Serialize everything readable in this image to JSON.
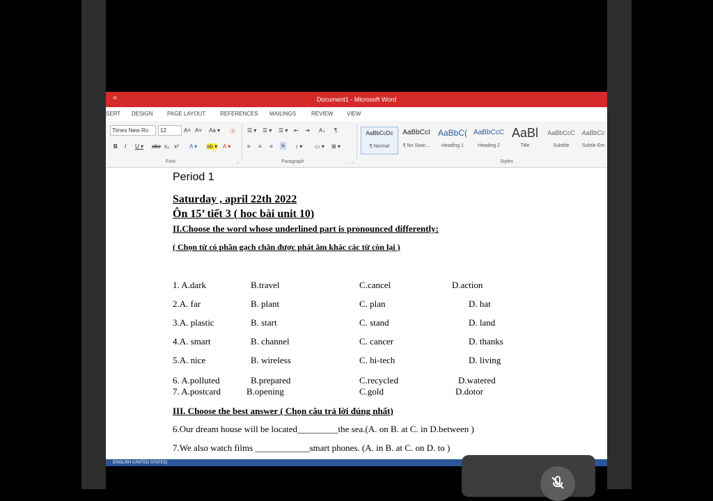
{
  "window": {
    "title": "Document1 - Microsoft Word",
    "quick_access": "="
  },
  "menu": [
    "SERT",
    "DESIGN",
    "PAGE LAYOUT",
    "REFERENCES",
    "MAILINGS",
    "REVIEW",
    "VIEW"
  ],
  "ribbon": {
    "font_name": "Times New Ro",
    "font_size": "12",
    "font_row1": [
      "A˄",
      "A˅",
      "Aa ▾",
      "ⓐ"
    ],
    "font_row2": [
      "B",
      "I",
      "U ▾",
      "abc",
      "x₂",
      "x²",
      "A ▾",
      "ab ▾",
      "A ▾"
    ],
    "paragraph_row1": [
      "☰ ▾",
      "☰ ▾",
      "☰ ▾",
      "⇤",
      "⇥",
      "A↓",
      "¶"
    ],
    "paragraph_row2": [
      "≡",
      "≡",
      "≡",
      "≡",
      "↕ ▾",
      "▭ ▾",
      "⊞ ▾"
    ],
    "groups": {
      "font": "Font",
      "paragraph": "Paragraph",
      "styles": "Styles"
    },
    "styles": [
      {
        "preview": "AaBbCcDc",
        "name": "¶ Normal"
      },
      {
        "preview": "AaBbCcI",
        "name": "¶ No Spac..."
      },
      {
        "preview": "AaBbC(",
        "name": "Heading 1"
      },
      {
        "preview": "AaBbCcC",
        "name": "Heading 2"
      },
      {
        "preview": "AaBl",
        "name": "Title"
      },
      {
        "preview": "AaBbCcC",
        "name": "Subtitle"
      },
      {
        "preview": "AaBbCc",
        "name": "Subtle Em"
      }
    ]
  },
  "document": {
    "period": "Period 1",
    "date": "Saturday , april 22th  2022",
    "subtitle": "Ôn 15’ tiết 3 ( hoc bài unit 10)",
    "section2": "II.Choose the word whose underlined part is pronounced differently:",
    "section2_vn": "( Chọn từ có phần gạch chân được phát âm khác các từ còn lại )",
    "pronunciation_rows": [
      [
        "1. A.dark",
        "B.travel",
        "C.cancel",
        "D.action"
      ],
      [
        "2.A. far",
        "B. plant",
        "C. plan",
        "D. hat"
      ],
      [
        "3.A. plastic",
        "B. start",
        "C. stand",
        "D. land"
      ],
      [
        "4.A. smart",
        "B. channel",
        "C. cancer",
        "D. thanks"
      ],
      [
        "5.A. nice",
        "B. wireless",
        "C. hi-tech",
        "D. living"
      ],
      [
        "6. A.polluted",
        "B.prepared",
        "C.recycled",
        "D.watered"
      ],
      [
        "7.  A.postcard",
        "B.opening",
        "C.gold",
        "D.dotor"
      ]
    ],
    "section3": "III. Choose the best answer ( Chọn câu trả lời đúng nhất)",
    "q6": "6.Our dream house will be located_________the sea.(A. on  B. at   C. in   D.between )",
    "q7": "7.We also watch films ____________smart phones.  (A. in  B. at   C. on  D. to  )"
  },
  "status": {
    "language": "ENGLISH (UNITED STATES)"
  },
  "colors": {
    "title_bar": "#d42a2a",
    "status_bar": "#2b579a",
    "overlay": "#3c3c3c"
  },
  "overlay_icon": "mic-off-icon"
}
